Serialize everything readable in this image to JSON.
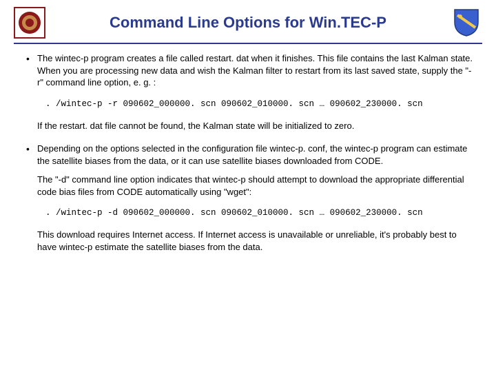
{
  "header": {
    "title": "Command Line Options for Win.TEC-P"
  },
  "b1": {
    "p1": "The wintec-p program creates a file called restart. dat when it finishes. This file contains the last Kalman state. When you are processing new data and wish the Kalman filter to restart from its last saved state, supply the \"-r\" command line option, e. g. :",
    "code": ". /wintec-p -r 090602_000000. scn 090602_010000. scn … 090602_230000. scn",
    "p2": "If the restart. dat file cannot be found, the Kalman state will be initialized to zero."
  },
  "b2": {
    "p1": "Depending on the options selected in the configuration file wintec-p. conf, the wintec-p program can estimate the satellite biases from the data, or it can use satellite biases downloaded from CODE.",
    "p2": "The \"-d\" command line option indicates that wintec-p should attempt to download the appropriate differential code bias files from CODE automatically using \"wget\":",
    "code": ". /wintec-p -d 090602_000000. scn 090602_010000. scn … 090602_230000. scn",
    "p3": "This download requires Internet access. If Internet access is unavailable or unreliable, it's probably best to have wintec-p estimate the satellite biases from the data."
  }
}
